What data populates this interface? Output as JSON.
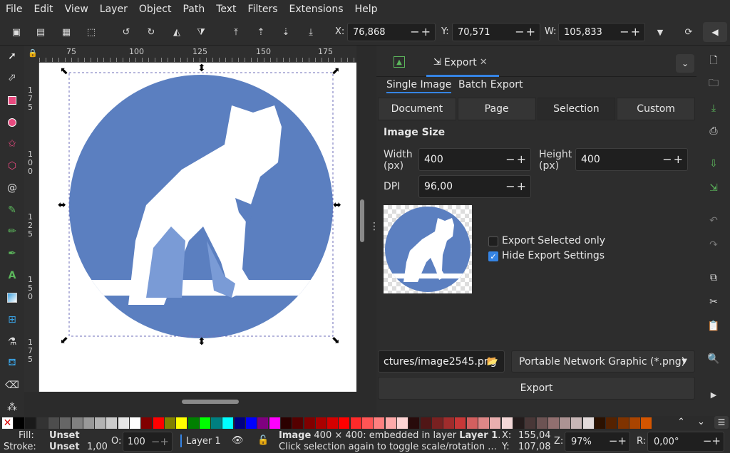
{
  "menu": [
    "File",
    "Edit",
    "View",
    "Layer",
    "Object",
    "Path",
    "Text",
    "Filters",
    "Extensions",
    "Help"
  ],
  "toolbar": {
    "x_label": "X:",
    "x_value": "76,868",
    "y_label": "Y:",
    "y_value": "70,571",
    "w_label": "W:",
    "w_value": "105,833"
  },
  "ruler": {
    "top": [
      "75",
      "100",
      "125",
      "150",
      "175"
    ],
    "left": [
      "1",
      "7",
      "5",
      "1",
      "0",
      "0",
      "1",
      "2",
      "5",
      "1",
      "5",
      "0",
      "1",
      "7",
      "5"
    ]
  },
  "dialog": {
    "tab_label": "Export",
    "subtabs": [
      "Single Image",
      "Batch Export"
    ],
    "segments": [
      "Document",
      "Page",
      "Selection",
      "Custom"
    ],
    "active_segment": "Selection",
    "image_size_title": "Image Size",
    "width_label": "Width\n(px)",
    "width_value": "400",
    "height_label": "Height\n(px)",
    "height_value": "400",
    "dpi_label": "DPI",
    "dpi_value": "96,00",
    "export_selected_label": "Export Selected only",
    "hide_export_label": "Hide Export Settings",
    "filename": "ctures/image2545.png",
    "format": "Portable Network Graphic (*.png)",
    "export_button": "Export"
  },
  "palette_colors": [
    "#000000",
    "#1a1a1a",
    "#333333",
    "#4d4d4d",
    "#666666",
    "#808080",
    "#999999",
    "#b3b3b3",
    "#cccccc",
    "#e6e6e6",
    "#ffffff",
    "#800000",
    "#ff0000",
    "#808000",
    "#ffff00",
    "#008000",
    "#00ff00",
    "#008080",
    "#00ffff",
    "#000080",
    "#0000ff",
    "#800080",
    "#ff00ff",
    "#2b0000",
    "#550000",
    "#800000",
    "#aa0000",
    "#d40000",
    "#ff0000",
    "#ff2a2a",
    "#ff5555",
    "#ff8080",
    "#ffaaaa",
    "#ffd5d5",
    "#280b0b",
    "#501616",
    "#782121",
    "#a02c2c",
    "#c83737",
    "#d35f5f",
    "#de8787",
    "#e9afaf",
    "#f4d7d7",
    "#241c1c",
    "#483737",
    "#6c5353",
    "#916f6f",
    "#ac9393",
    "#c8b7b7",
    "#e3dbdb",
    "#2b1100",
    "#552200",
    "#803300",
    "#aa4400",
    "#d45500"
  ],
  "status": {
    "fill_label": "Fill:",
    "fill_value": "Unset",
    "stroke_label": "Stroke:",
    "stroke_value": "Unset",
    "stroke_width": "1,00",
    "opacity_label": "O:",
    "opacity_value": "100",
    "layer": "Layer 1",
    "msg_bold": "Image",
    "msg_line1": " 400 × 400: embedded in layer ",
    "msg_layer": "Layer 1",
    "msg_end": ".",
    "msg_line2": "Click selection again to toggle scale/rotation ...",
    "x_label": "X:",
    "x_value": "155,04",
    "y_label": "Y:",
    "y_value": "107,08",
    "z_label": "Z:",
    "zoom": "97%",
    "r_label": "R:",
    "rotation": "0,00°"
  },
  "colors": {
    "accent": "#3584e4",
    "circle": "#5b7fc0",
    "figure_mid": "#7a9bd6"
  }
}
